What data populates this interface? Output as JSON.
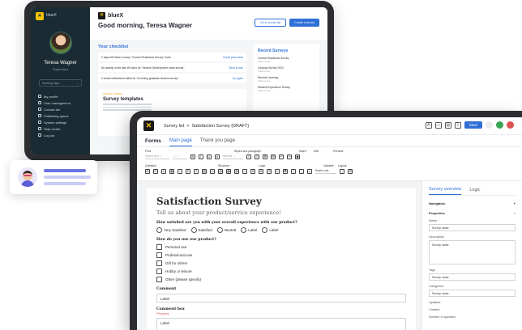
{
  "back_tablet": {
    "app_name": "blueX",
    "user": {
      "name": "Teresa Wagner",
      "role": "Supervisor"
    },
    "sidebar_select": "Working days",
    "menu": [
      "My profile",
      "User management",
      "Contact list",
      "Publishing queue",
      "System settings",
      "Help center",
      "Log out"
    ],
    "greeting": "Good morning, Teresa Wagner",
    "buttons": {
      "goto": "Go to survey list",
      "create": "Create a survey"
    },
    "checklist_title": "Your checklist",
    "checklist": [
      {
        "text": "2 days left before survey “Course Readiness Survey” ends",
        "link": "Check your tasks"
      },
      {
        "text": "No activity in the last 48 hours for “Service Development news survey”",
        "link": "Send a note"
      },
      {
        "text": "3 email notifications failed for “Incoming graduate student survey”",
        "link": "Try again"
      }
    ],
    "templates": {
      "tag": "WHAT'S COMING",
      "title": "Survey templates"
    },
    "recent_title": "Recent Surveys",
    "recent": [
      {
        "name": "Course Readiness Survey",
        "sub": "Online survey"
      },
      {
        "name": "Campus Survey 2023",
        "sub": "Online survey"
      },
      {
        "name": "Remote Learning",
        "sub": "Online survey"
      },
      {
        "name": "Student Experience Survey",
        "sub": "Online survey"
      }
    ]
  },
  "front_tablet": {
    "breadcrumb": [
      "Survey list",
      ">",
      "Satisfaction Survey (DRAFT)"
    ],
    "save_label": "Save",
    "tabs": {
      "forms": "Forms",
      "main": "Main page",
      "thanks": "Thank you page"
    },
    "ribbon": {
      "font": "Font",
      "styles": "Styles and paragraph",
      "insert": "Insert",
      "edit": "Edit",
      "preview": "Preview",
      "question": "Question",
      "structure": "Structure",
      "logic": "Logic",
      "variable": "Variable",
      "layout": "Layout",
      "layout_value": "Sudfd cols"
    },
    "survey": {
      "title": "Satisfaction Survey",
      "subtitle": "Tell us about your product/service experience!",
      "q1": "How satisfied are you with your overall experience with our product?",
      "q1_options": [
        "Very Satisfied",
        "Satisfied",
        "Neutral",
        "Label",
        "Label"
      ],
      "q2": "How do you use our product?",
      "q2_options": [
        "Personal use",
        "Professional use",
        "Gift for others",
        "Hobby or leisure",
        "Other (please specify)"
      ],
      "comment_label": "Comment",
      "comment_value": "Label",
      "comment_box_label": "Comment box",
      "required": "*Requires",
      "comment_box_value": "Label"
    },
    "panel": {
      "tabs": [
        "Survey overview",
        "Logic"
      ],
      "navigation": "Navigation",
      "properties": "Properties",
      "name_label": "Name",
      "name_value": "Survey name",
      "description_label": "Description",
      "description_value": "Survey name",
      "tags_label": "Tags",
      "tags_value": "Survey name",
      "categories_label": "Categories",
      "categories_value": "Survey name",
      "updated_label": "Updated",
      "created_label": "Created",
      "questions_label": "Number of question"
    }
  },
  "colors": {
    "accent": "#2f6fd6",
    "sidebar": "#1a2b33",
    "logo": "#f5c400"
  }
}
